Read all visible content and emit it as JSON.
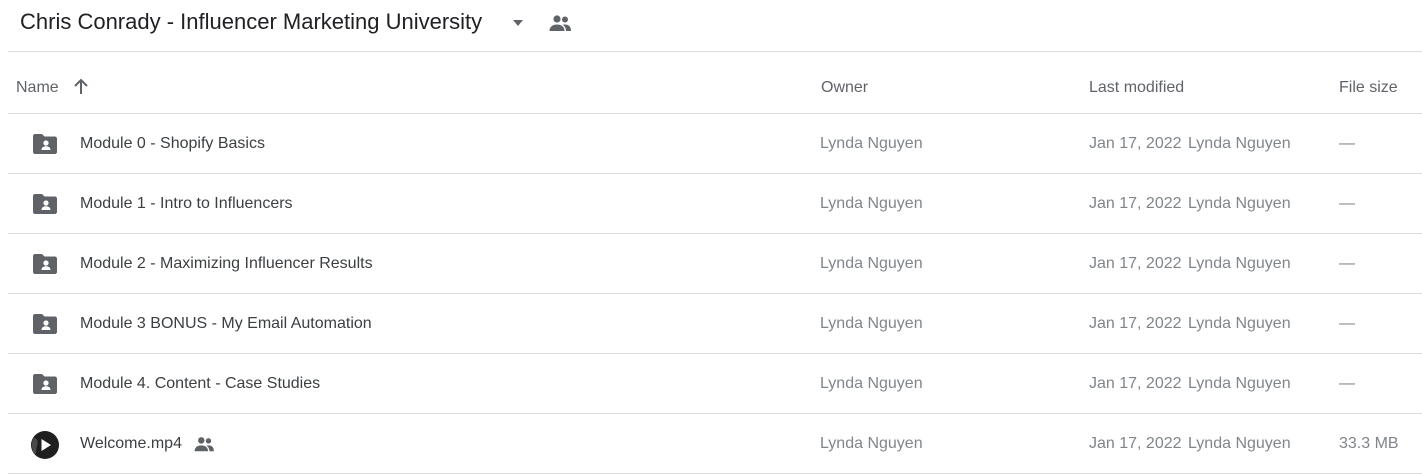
{
  "folder": {
    "title": "Chris Conrady - Influencer Marketing University",
    "caret_icon": "arrow-drop-down-icon",
    "shared_icon": "people-icon"
  },
  "columns": {
    "name": "Name",
    "owner": "Owner",
    "last_modified": "Last modified",
    "file_size": "File size",
    "sort_icon": "arrow-up-icon"
  },
  "rows": [
    {
      "type": "shared-folder",
      "name": "Module 0 - Shopify  Basics",
      "owner": "Lynda Nguyen",
      "modified_date": "Jan 17, 2022",
      "modified_by": "Lynda Nguyen",
      "size": "—"
    },
    {
      "type": "shared-folder",
      "name": "Module 1 - Intro to Influencers",
      "owner": "Lynda Nguyen",
      "modified_date": "Jan 17, 2022",
      "modified_by": "Lynda Nguyen",
      "size": "—"
    },
    {
      "type": "shared-folder",
      "name": "Module 2 - Maximizing Influencer Results",
      "owner": "Lynda Nguyen",
      "modified_date": "Jan 17, 2022",
      "modified_by": "Lynda Nguyen",
      "size": "—"
    },
    {
      "type": "shared-folder",
      "name": "Module 3 BONUS - My Email Automation",
      "owner": "Lynda Nguyen",
      "modified_date": "Jan 17, 2022",
      "modified_by": "Lynda Nguyen",
      "size": "—"
    },
    {
      "type": "shared-folder",
      "name": "Module 4. Content - Case Studies",
      "owner": "Lynda Nguyen",
      "modified_date": "Jan 17, 2022",
      "modified_by": "Lynda Nguyen",
      "size": "—"
    },
    {
      "type": "video",
      "name": "Welcome.mp4",
      "owner": "Lynda Nguyen",
      "modified_date": "Jan 17, 2022",
      "modified_by": "Lynda Nguyen",
      "size": "33.3 MB",
      "shared": true
    }
  ],
  "colors": {
    "divider": "#dadce0",
    "icon": "#5f6368",
    "text_primary": "#3c4043",
    "text_secondary": "#80868b"
  }
}
